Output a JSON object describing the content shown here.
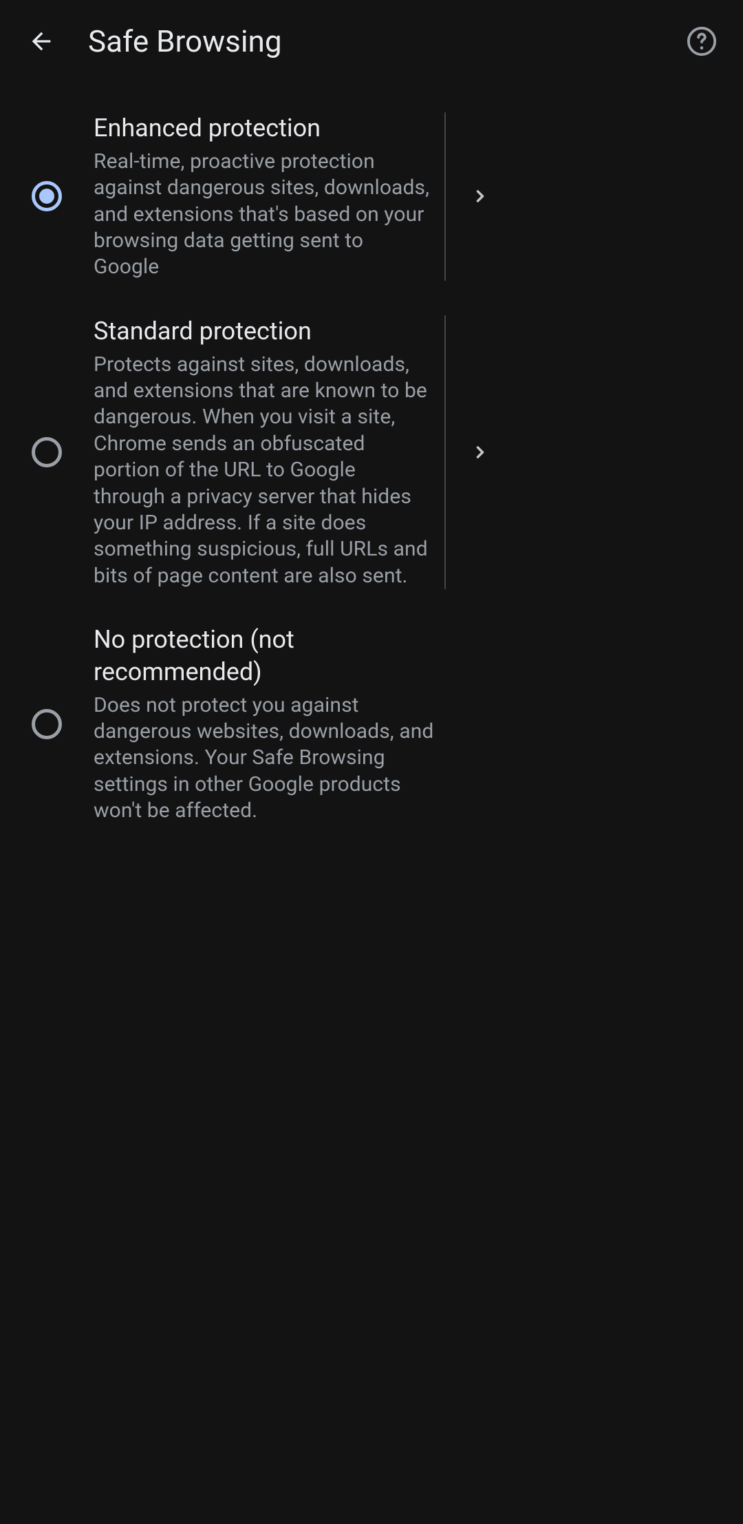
{
  "header": {
    "title": "Safe Browsing"
  },
  "options": {
    "0": {
      "title": "Enhanced protection",
      "desc": "Real-time, proactive protection against dangerous sites, downloads, and extensions that's based on your browsing data getting sent to Google"
    },
    "1": {
      "title": "Standard protection",
      "desc": "Protects against sites, downloads, and extensions that are known to be dangerous. When you visit a site, Chrome sends an obfuscated portion of the URL to Google through a privacy server that hides your IP address. If a site does something suspicious, full URLs and bits of page content are also sent."
    },
    "2": {
      "title": "No protection (not recommended)",
      "desc": "Does not protect you against dangerous websites, downloads, and extensions. Your Safe Browsing settings in other Google products won't be affected."
    }
  },
  "selected_index": 0
}
